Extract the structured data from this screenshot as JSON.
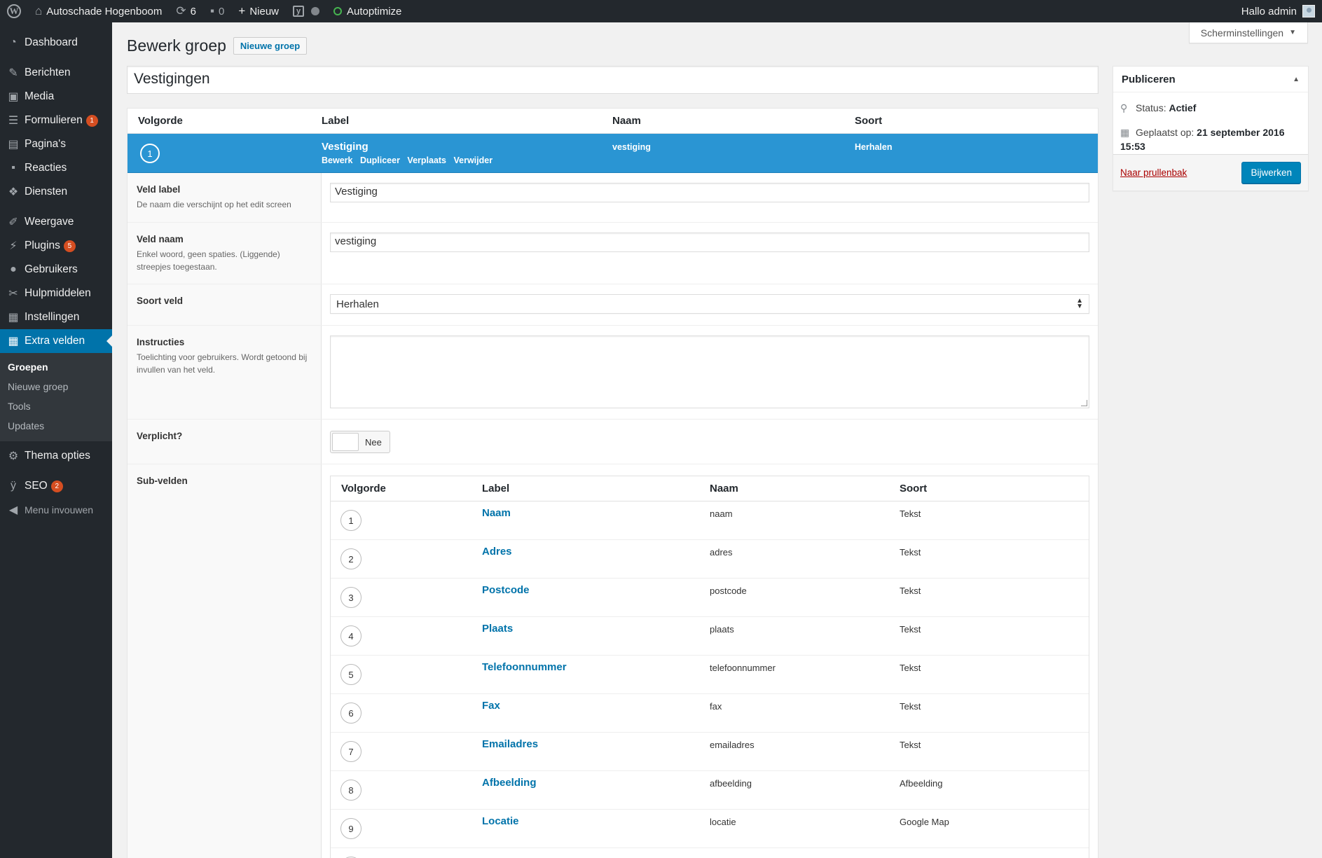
{
  "adminbar": {
    "site_name": "Autoschade Hogenboom",
    "updates_count": "6",
    "comments_count": "0",
    "new_label": "Nieuw",
    "autoptimize_label": "Autoptimize",
    "greeting": "Hallo admin"
  },
  "sidebar": {
    "items": [
      {
        "label": "Dashboard",
        "icon": "dashboard-icon"
      },
      {
        "label": "Berichten",
        "icon": "pin-icon"
      },
      {
        "label": "Media",
        "icon": "media-icon"
      },
      {
        "label": "Formulieren",
        "icon": "forms-icon",
        "badge": "1"
      },
      {
        "label": "Pagina's",
        "icon": "page-icon"
      },
      {
        "label": "Reacties",
        "icon": "comment-icon"
      },
      {
        "label": "Diensten",
        "icon": "services-icon"
      },
      {
        "label": "Weergave",
        "icon": "brush-icon"
      },
      {
        "label": "Plugins",
        "icon": "plugin-icon",
        "badge": "5"
      },
      {
        "label": "Gebruikers",
        "icon": "user-icon"
      },
      {
        "label": "Hulpmiddelen",
        "icon": "wrench-icon"
      },
      {
        "label": "Instellingen",
        "icon": "settings-icon"
      },
      {
        "label": "Extra velden",
        "icon": "table-icon"
      }
    ],
    "submenu": [
      "Groepen",
      "Nieuwe groep",
      "Tools",
      "Updates"
    ],
    "after": [
      {
        "label": "Thema opties",
        "icon": "gear-icon"
      },
      {
        "label": "SEO",
        "icon": "yoast-icon",
        "badge": "2"
      },
      {
        "label": "Menu invouwen",
        "icon": "collapse-icon"
      }
    ]
  },
  "screen_options": "Scherminstellingen",
  "page": {
    "title": "Bewerk groep",
    "add_new": "Nieuwe groep",
    "group_title": "Vestigingen"
  },
  "fields": {
    "headers": {
      "order": "Volgorde",
      "label": "Label",
      "name": "Naam",
      "type": "Soort"
    },
    "active": {
      "order": "1",
      "label": "Vestiging",
      "actions": [
        "Bewerk",
        "Dupliceer",
        "Verplaats",
        "Verwijder"
      ],
      "name": "vestiging",
      "type": "Herhalen"
    },
    "settings": {
      "label_title": "Veld label",
      "label_desc": "De naam die verschijnt op het edit screen",
      "label_value": "Vestiging",
      "name_title": "Veld naam",
      "name_desc": "Enkel woord, geen spaties. (Liggende) streepjes toegestaan.",
      "name_value": "vestiging",
      "type_title": "Soort veld",
      "type_value": "Herhalen",
      "instructions_title": "Instructies",
      "instructions_desc": "Toelichting voor gebruikers. Wordt getoond bij invullen van het veld.",
      "required_title": "Verplicht?",
      "required_value": "Nee",
      "subfields_title": "Sub-velden"
    },
    "subfields": {
      "headers": {
        "order": "Volgorde",
        "label": "Label",
        "name": "Naam",
        "type": "Soort"
      },
      "rows": [
        {
          "order": "1",
          "label": "Naam",
          "name": "naam",
          "type": "Tekst"
        },
        {
          "order": "2",
          "label": "Adres",
          "name": "adres",
          "type": "Tekst"
        },
        {
          "order": "3",
          "label": "Postcode",
          "name": "postcode",
          "type": "Tekst"
        },
        {
          "order": "4",
          "label": "Plaats",
          "name": "plaats",
          "type": "Tekst"
        },
        {
          "order": "5",
          "label": "Telefoonnummer",
          "name": "telefoonnummer",
          "type": "Tekst"
        },
        {
          "order": "6",
          "label": "Fax",
          "name": "fax",
          "type": "Tekst"
        },
        {
          "order": "7",
          "label": "Emailadres",
          "name": "emailadres",
          "type": "Tekst"
        },
        {
          "order": "8",
          "label": "Afbeelding",
          "name": "afbeelding",
          "type": "Afbeelding"
        },
        {
          "order": "9",
          "label": "Locatie",
          "name": "locatie",
          "type": "Google Map"
        }
      ]
    }
  },
  "publish": {
    "title": "Publiceren",
    "status_label": "Status:",
    "status_value": "Actief",
    "date_label": "Geplaatst op:",
    "date_value": "21 september 2016",
    "time_value": "15:53",
    "trash": "Naar prullenbak",
    "update": "Bijwerken"
  }
}
